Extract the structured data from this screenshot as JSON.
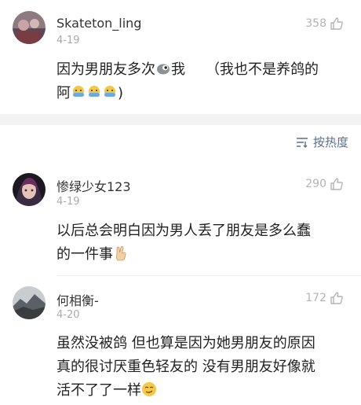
{
  "comments": [
    {
      "username": "Skateton_ling",
      "date": "4-19",
      "likes": "358",
      "text_lines": [
        "因为男朋友多次",
        "我",
        "（我也不是养鸽的",
        "阿",
        ")"
      ]
    },
    {
      "username": "惨绿少女123",
      "date": "4-19",
      "likes": "290",
      "text_lines": [
        "以后总会明白因为男人丢了朋友是多么蠢",
        "的一件事"
      ]
    },
    {
      "username": "何相衡-",
      "date": "4-20",
      "likes": "172",
      "text_lines": [
        "虽然没被鸽 但也算是因为她男朋友的原因",
        "真的很讨厌重色轻友的 没有男朋友好像就",
        "活不了了一样"
      ]
    }
  ],
  "sort": {
    "label": "按热度"
  },
  "colors": {
    "link_blue": "#5b6f91",
    "muted_gray": "#aaaaaa",
    "divider": "#f2f2f2"
  }
}
